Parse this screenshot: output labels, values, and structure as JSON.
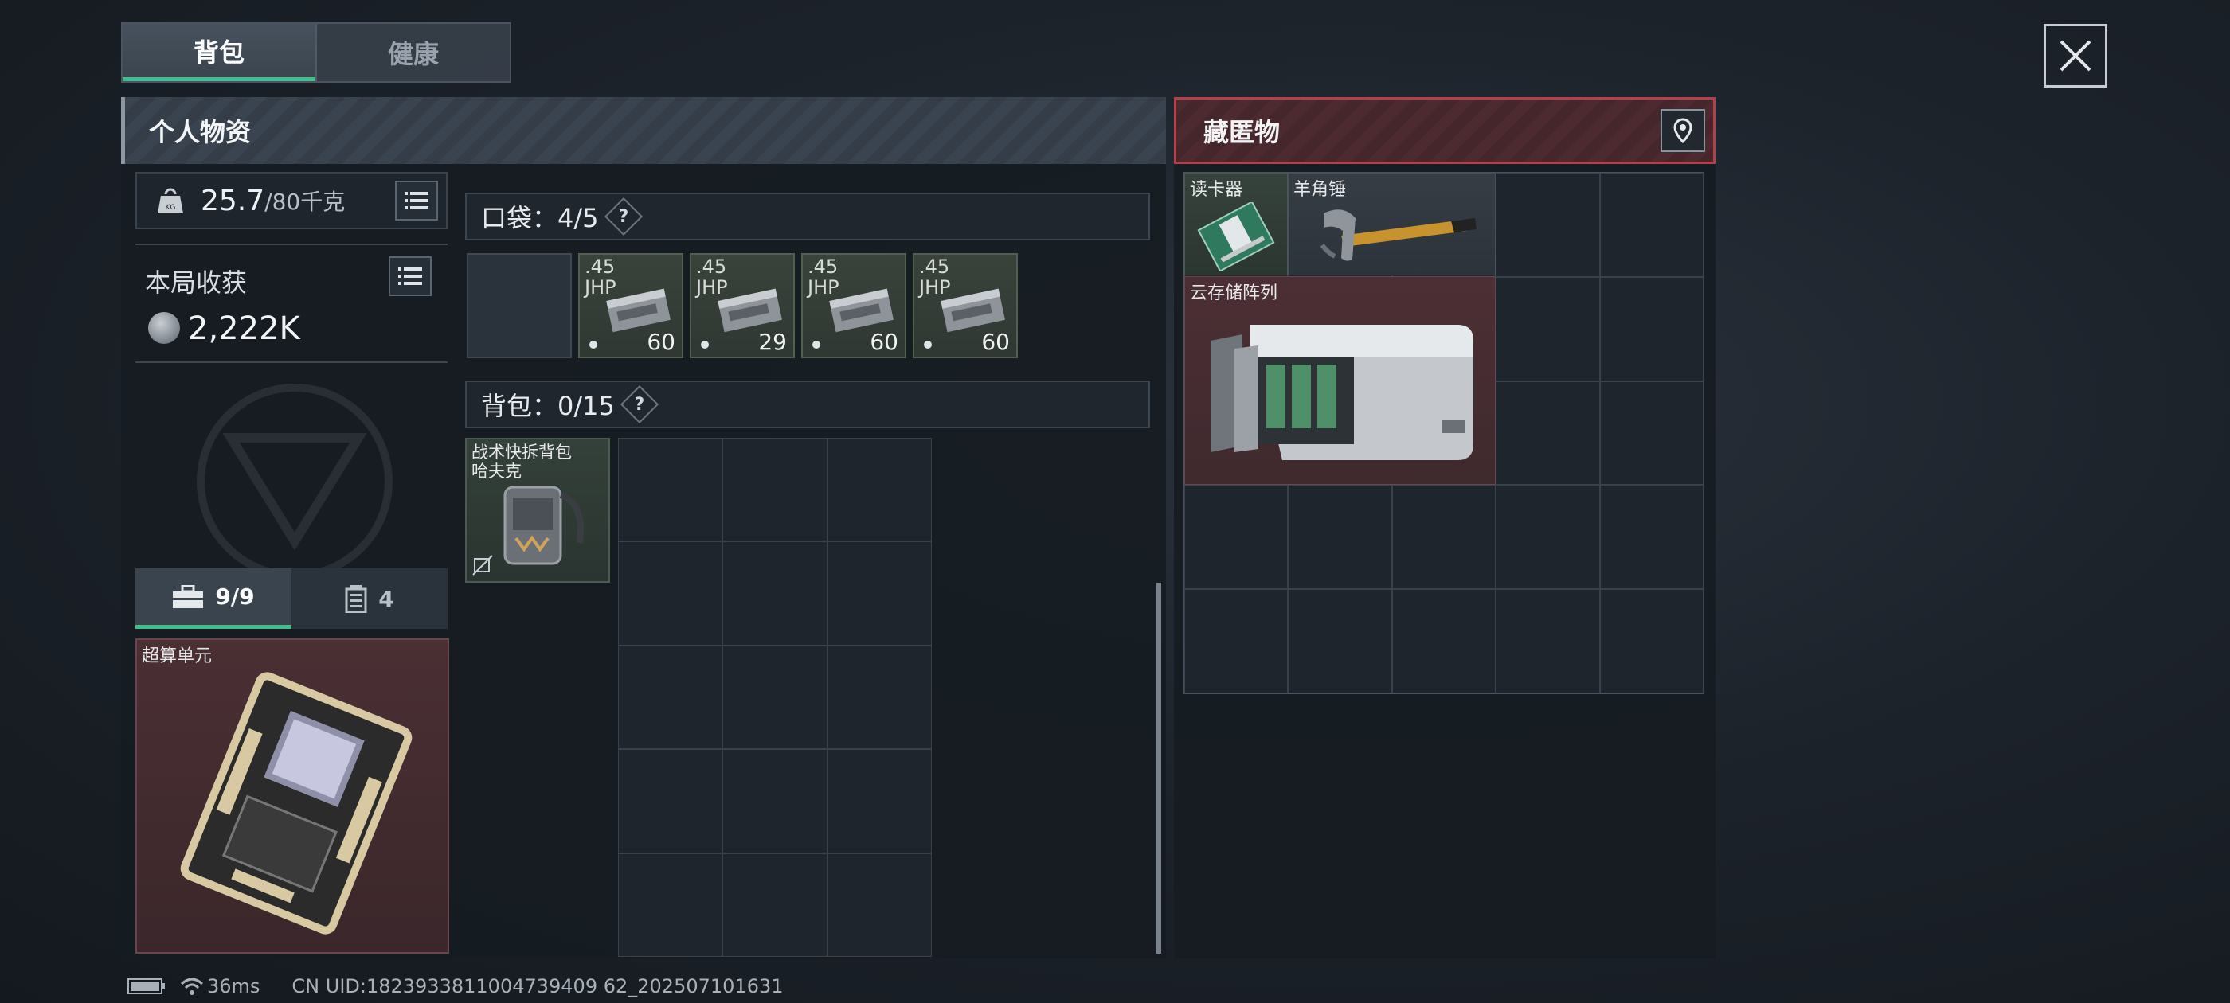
{
  "tabs": [
    {
      "label": "背包",
      "active": true
    },
    {
      "label": "健康",
      "active": false
    }
  ],
  "left_panel": {
    "title": "个人物资",
    "weight": {
      "current": "25.7",
      "max": "/80千克"
    },
    "loot": {
      "label": "本局收获",
      "value": "2,222K"
    },
    "subtabs": [
      {
        "icon": "toolbox-icon",
        "label": "9/9",
        "active": true
      },
      {
        "icon": "canister-icon",
        "label": "4",
        "active": false
      }
    ],
    "secure_item": {
      "name": "超算单元",
      "rarity_color": "#4a2f33"
    }
  },
  "pockets": {
    "label": "口袋：4/5",
    "help": "?",
    "slots": [
      {
        "empty": true
      },
      {
        "caliber": ".45\nJHP",
        "count": "60"
      },
      {
        "caliber": ".45\nJHP",
        "count": "29"
      },
      {
        "caliber": ".45\nJHP",
        "count": "60"
      },
      {
        "caliber": ".45\nJHP",
        "count": "60"
      }
    ]
  },
  "backpack": {
    "label": "背包：0/15",
    "help": "?",
    "equipped": {
      "name": "战术快拆背包\n哈夫克"
    }
  },
  "stash": {
    "title": "藏匿物",
    "items": [
      {
        "name": "读卡器",
        "rarity": "green"
      },
      {
        "name": "羊角锤",
        "rarity": "gray"
      },
      {
        "name": "云存储阵列",
        "rarity": "red"
      }
    ]
  },
  "status_bar": {
    "ping": "36ms",
    "uid": "CN UID:1823933811004739409 62_202507101631"
  },
  "colors": {
    "accent_green": "#3fbf8c",
    "stash_red": "#b3414b",
    "rarity_red": "#4c2f34",
    "rarity_green": "#36423c"
  }
}
